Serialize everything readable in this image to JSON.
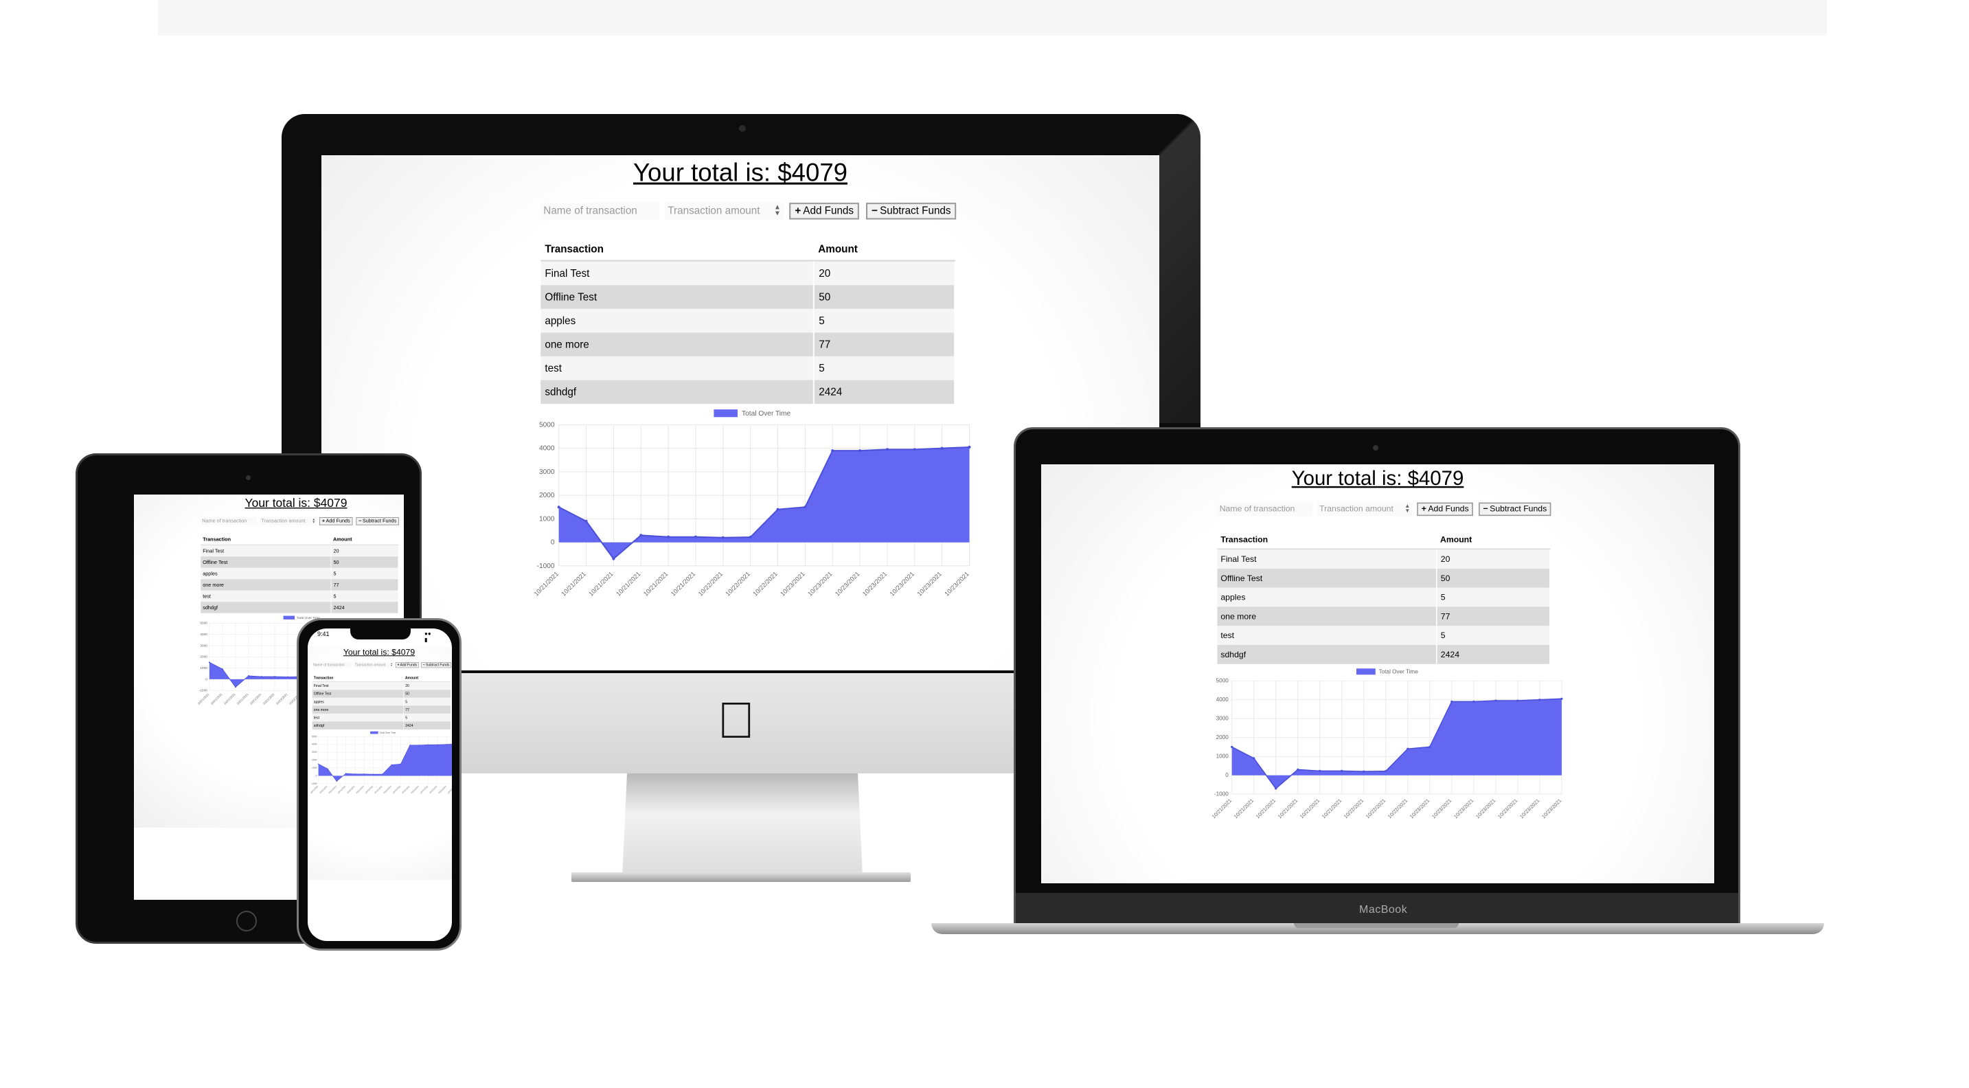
{
  "app": {
    "total_text": "Your total is: $4079",
    "name_placeholder": "Name of transaction",
    "amount_placeholder": "Transaction amount",
    "add_label": "Add Funds",
    "subtract_label": "Subtract Funds",
    "table": {
      "headers": [
        "Transaction",
        "Amount"
      ],
      "rows": [
        {
          "name": "Final Test",
          "amount": "20"
        },
        {
          "name": "Offline Test",
          "amount": "50"
        },
        {
          "name": "apples",
          "amount": "5"
        },
        {
          "name": "one more",
          "amount": "77"
        },
        {
          "name": "test",
          "amount": "5"
        },
        {
          "name": "sdhdgf",
          "amount": "2424"
        }
      ]
    }
  },
  "devices": {
    "laptop_brand": "MacBook",
    "phone_time": "9:41"
  },
  "colors": {
    "series": "#6367f2",
    "grid": "#e6e6e6"
  },
  "chart_data": {
    "type": "area",
    "legend": [
      "Total Over Time"
    ],
    "legend_position": "top",
    "ylim": [
      -1000,
      5000
    ],
    "yticks": [
      5000,
      4000,
      3000,
      2000,
      1000,
      0,
      -1000
    ],
    "grid": true,
    "x": [
      "10/21/2021",
      "10/21/2021",
      "10/21/2021",
      "10/21/2021",
      "10/21/2021",
      "10/21/2021",
      "10/22/2021",
      "10/22/2021",
      "10/22/2021",
      "10/23/2021",
      "10/23/2021",
      "10/23/2021",
      "10/23/2021",
      "10/23/2021",
      "10/23/2021",
      "10/23/2021"
    ],
    "series": [
      {
        "name": "Total Over Time",
        "values": [
          1500,
          900,
          -700,
          300,
          230,
          230,
          200,
          220,
          1400,
          1500,
          3900,
          3900,
          3950,
          3950,
          4000,
          4050
        ]
      }
    ]
  }
}
